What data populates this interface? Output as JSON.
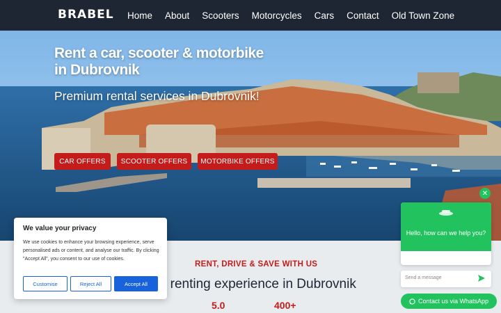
{
  "nav": {
    "logo": "BRABEL",
    "items": [
      "Home",
      "About",
      "Scooters",
      "Motorcycles",
      "Cars",
      "Contact",
      "Old Town Zone"
    ]
  },
  "hero": {
    "title_line1": "Rent a car, scooter & motorbike",
    "title_line2": "in Dubrovnik",
    "subtitle": "Premium rental services in Dubrovnik!",
    "buttons": [
      "CAR OFFERS",
      "SCOOTER OFFERS",
      "MOTORBIKE OFFERS"
    ]
  },
  "section": {
    "kicker": "RENT, DRIVE & SAVE WITH US",
    "headline": "est renting experience in Dubrovnik",
    "stats": [
      "5.0",
      "400+"
    ]
  },
  "cookie": {
    "title": "We value your privacy",
    "text": "We use cookies to enhance your browsing experience, serve personalised ads or content, and analyse our traffic. By clicking \"Accept All\", you consent to our use of cookies.",
    "customise": "Customise",
    "reject": "Reject All",
    "accept": "Accept All"
  },
  "chat": {
    "message": "Hello, how can we help you?",
    "input_placeholder": "Send a message",
    "whatsapp": "Contact us via WhatsApp"
  },
  "colors": {
    "nav_bg": "#1e2533",
    "accent_red": "#c41b1b",
    "whatsapp_green": "#22c35e",
    "cookie_blue": "#1863dc"
  },
  "icons": [
    "close-icon",
    "send-icon",
    "whatsapp-icon",
    "chat-avatar-icon"
  ]
}
